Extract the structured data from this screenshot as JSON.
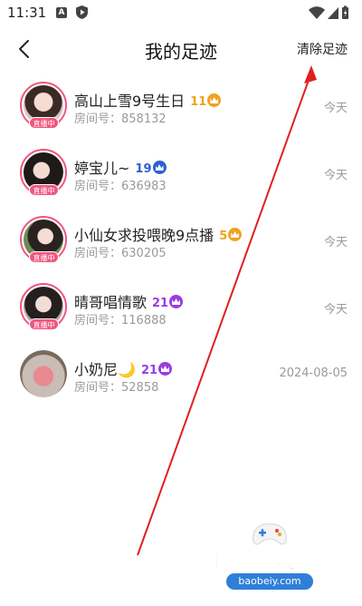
{
  "status_bar": {
    "time": "11:31",
    "a_icon_label": "A"
  },
  "header": {
    "title": "我的足迹",
    "clear_label": "清除足迹"
  },
  "live_label": "直播中",
  "room_prefix": "房间号：",
  "items": [
    {
      "name": "高山上雪9号生日",
      "level": "11",
      "level_color": "#f0a21e",
      "room": "858132",
      "time": "今天",
      "live": true
    },
    {
      "name": "婷宝儿~",
      "level": "19",
      "level_color": "#2f5fd0",
      "room": "636983",
      "time": "今天",
      "live": true
    },
    {
      "name": "小仙女求投喂晚9点播",
      "level": "5",
      "level_color": "#f0a21e",
      "room": "630205",
      "time": "今天",
      "live": true
    },
    {
      "name": "晴哥唱情歌",
      "level": "21",
      "level_color": "#9a3de0",
      "room": "116888",
      "time": "今天",
      "live": true
    },
    {
      "name": "小奶尼🌙",
      "level": "21",
      "level_color": "#9a3de0",
      "room": "52858",
      "time": "2024-08-05",
      "live": false
    }
  ],
  "watermark": {
    "text": "宝贝游戏网",
    "url": "baobeiy.com"
  },
  "colors": {
    "live_pink": "#f2557f",
    "muted_text": "#9a9a9a",
    "arrow_red": "#e02020"
  }
}
